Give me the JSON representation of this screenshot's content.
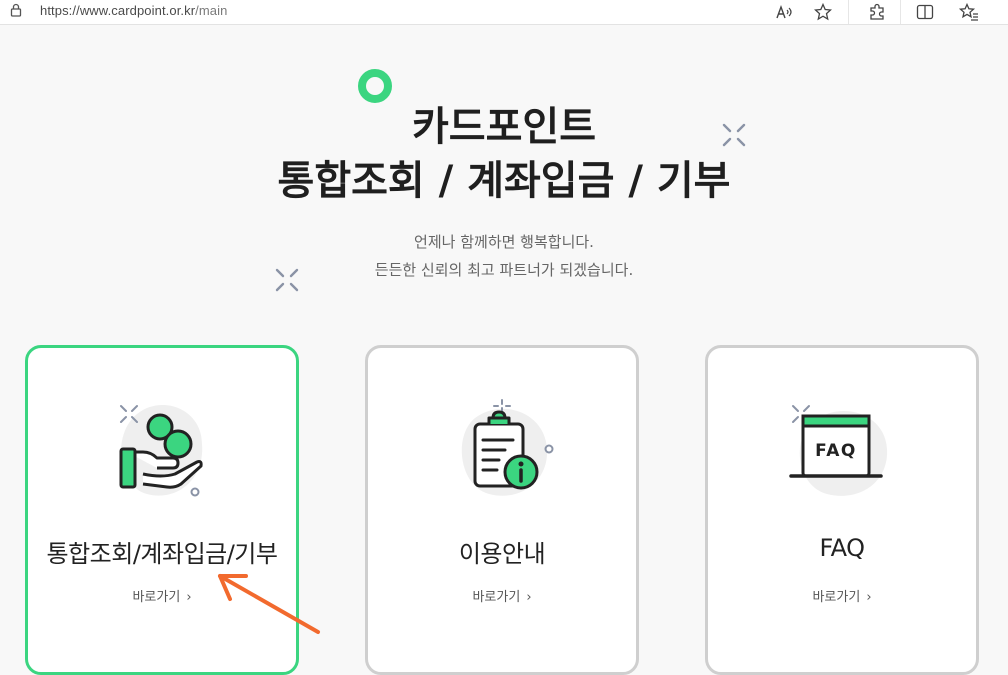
{
  "browser": {
    "url_host": "https://www.cardpoint.or.kr",
    "url_path": "/main",
    "icons": [
      "lock-icon",
      "read-aloud-icon",
      "favorite-star-icon",
      "extensions-icon",
      "split-screen-icon",
      "favorites-list-icon"
    ]
  },
  "hero": {
    "title_line1": "카드포인트",
    "title_line2": "통합조회 / 계좌입금 / 기부",
    "subtitle_line1": "언제나 함께하면 행복합니다.",
    "subtitle_line2": "든든한 신뢰의 최고 파트너가 되겠습니다."
  },
  "cards": [
    {
      "title": "통합조회/계좌입금/기부",
      "link": "바로가기",
      "icon": "hand-coins-icon",
      "active": true
    },
    {
      "title": "이용안내",
      "link": "바로가기",
      "icon": "clipboard-info-icon",
      "active": false
    },
    {
      "title": "FAQ",
      "link": "바로가기",
      "icon": "faq-window-icon",
      "active": false
    }
  ],
  "colors": {
    "accent": "#3bd580",
    "arrow": "#f26a2e",
    "border": "#cfcfcf"
  }
}
